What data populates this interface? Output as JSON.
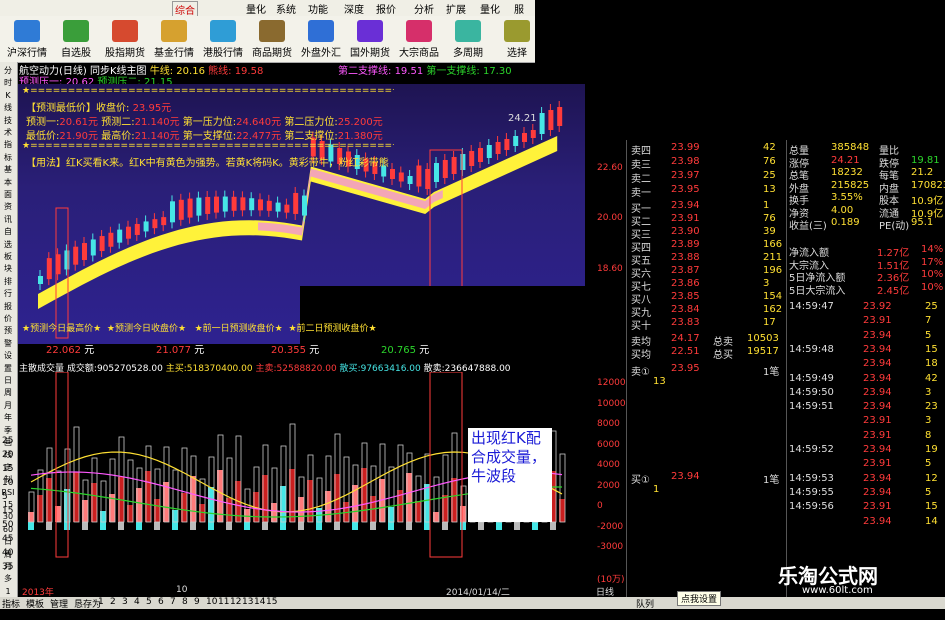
{
  "menu": {
    "items": [
      "综合",
      "量化",
      "系统",
      "功能",
      "深度",
      "报价",
      "分析",
      "扩展",
      "量化",
      "服"
    ],
    "active_index": 0
  },
  "toolbar": [
    {
      "label": "沪深行情",
      "icon": "market-icon",
      "color": "#2f7bd6"
    },
    {
      "label": "自选股",
      "icon": "favorites-icon",
      "color": "#3a9e3a"
    },
    {
      "label": "股指期货",
      "icon": "futures-icon",
      "color": "#d64a2f"
    },
    {
      "label": "基金行情",
      "icon": "fund-icon",
      "color": "#d6a12f"
    },
    {
      "label": "港股行情",
      "icon": "hk-icon",
      "color": "#2f9dd6"
    },
    {
      "label": "商品期货",
      "icon": "commodity-icon",
      "color": "#8a6a2f"
    },
    {
      "label": "外盘外汇",
      "icon": "forex-icon",
      "color": "#2f6fd6"
    },
    {
      "label": "国外期货",
      "icon": "foreign-futures-icon",
      "color": "#6a2fd6"
    },
    {
      "label": "大宗商品",
      "icon": "bulk-icon",
      "color": "#d62f6a"
    },
    {
      "label": "多周期",
      "icon": "multi-period-icon",
      "color": "#3ab5a0"
    },
    {
      "label": "选择",
      "icon": "select-icon",
      "color": "#9a9a2f"
    }
  ],
  "left_buttons": [
    "分",
    "时",
    "K",
    "线",
    "技",
    "术",
    "指",
    "标",
    "基",
    "本",
    "面",
    "资",
    "讯",
    "自",
    "选",
    "板",
    "块",
    "排",
    "行",
    "报",
    "价",
    "预",
    "警",
    "设",
    "置",
    "日",
    "周",
    "月",
    "年",
    "季",
    "画",
    "线",
    "定",
    "制",
    "RSI",
    "15",
    "30",
    "60",
    "日",
    "周",
    "月",
    "多",
    "1"
  ],
  "chart_title": {
    "text": "航空动力(日线) 同步K线主图",
    "ma_label": "牛线",
    "ma_value": "20.16",
    "ma2_label": "熊线",
    "ma2_value": "19.58",
    "line2_label": "第二支撑线",
    "line2_value": "19.51",
    "line1_label": "第一支撑线",
    "line1_value": "17.30"
  },
  "predict_header": {
    "label1": "预测压一",
    "value1": "20.62",
    "label2": "预测压二",
    "value2": "21.15"
  },
  "info_lines": {
    "line1": "【预测最低价】收盘价:",
    "line1_val": "23.95元",
    "line2a": "预测一:",
    "line2a_v": "20.61元",
    "line2b": "预测二:",
    "line2b_v": "21.140元",
    "line2c": "第一压力位:",
    "line2c_v": "24.640元",
    "line2d": "第二压力位:",
    "line2d_v": "25.200元",
    "line3a": "最低价:",
    "line3a_v": "21.90元",
    "line3b": "最高价:",
    "line3b_v": "21.140元",
    "line3c": "第一支撑位:",
    "line3c_v": "22.477元",
    "line3d": "第二支撑位:",
    "line3d_v": "21.380元",
    "usage": "【用法】红K买看K来。红K中有黄色为强势。若黄K将码K。黄彩带牛，粉红彩带熊"
  },
  "price_marks": [
    "22.60",
    "20.00",
    "18.60"
  ],
  "right_top_value": "24.21",
  "sep_line": "★================================================★",
  "predict_labels": {
    "a": "★预测今日最高价★",
    "b": "★预测今日收盘价★",
    "c": "★前一日预测收盘价★",
    "d": "★前二日预测收盘价★"
  },
  "predict_values": {
    "a": "22.062",
    "b": "21.077",
    "c": "20.355",
    "d": "20.765",
    "unit": "元"
  },
  "vol_header": {
    "a": "主散成交量",
    "b": "成交额",
    "b_v": "905270528.00",
    "c": "主买",
    "c_v": "518370400.00",
    "d": "主卖",
    "d_v": "52588820.00",
    "e": "散买",
    "e_v": "97663416.00",
    "f": "散卖",
    "f_v": "236647888.00"
  },
  "vol_axis": [
    "12000",
    "10000",
    "8000",
    "6000",
    "4000",
    "2000",
    "0",
    "-2000",
    "-3000"
  ],
  "vol_unit": "(10万)",
  "left_vol_axis": [
    "25",
    "20",
    "15",
    "10",
    "5",
    "15",
    "50",
    "45",
    "40",
    "35"
  ],
  "date_axis": {
    "left": "2013年",
    "mid": "10",
    "right": "2014/01/14/二"
  },
  "note": "出现红K配合成交量，牛波段",
  "orderbook": {
    "sells": [
      {
        "label": "卖四",
        "price": "23.99",
        "vol": "42"
      },
      {
        "label": "卖三",
        "price": "23.98",
        "vol": "76"
      },
      {
        "label": "卖二",
        "price": "23.97",
        "vol": "25"
      },
      {
        "label": "卖一",
        "price": "23.95",
        "vol": "13"
      }
    ],
    "buys": [
      {
        "label": "买一",
        "price": "23.94",
        "vol": "1"
      },
      {
        "label": "买二",
        "price": "23.91",
        "vol": "76"
      },
      {
        "label": "买三",
        "price": "23.90",
        "vol": "39"
      },
      {
        "label": "买四",
        "price": "23.89",
        "vol": "166"
      },
      {
        "label": "买五",
        "price": "23.88",
        "vol": "211"
      },
      {
        "label": "买六",
        "price": "23.87",
        "vol": "196"
      },
      {
        "label": "买七",
        "price": "23.86",
        "vol": "3"
      },
      {
        "label": "买八",
        "price": "23.85",
        "vol": "154"
      },
      {
        "label": "买九",
        "price": "23.84",
        "vol": "162"
      },
      {
        "label": "买十",
        "price": "23.83",
        "vol": "17"
      }
    ],
    "avg_sell": {
      "label": "卖均",
      "price": "24.17",
      "tlabel": "总卖",
      "tval": "10503"
    },
    "avg_buy": {
      "label": "买均",
      "price": "22.51",
      "tlabel": "总买",
      "tval": "19517"
    },
    "sell1_detail": {
      "label": "卖①",
      "price": "23.95",
      "count": "1笔",
      "vol": "13"
    },
    "buy1_detail": {
      "label": "买①",
      "price": "23.94",
      "count": "1笔",
      "vol": "1"
    }
  },
  "quote": [
    {
      "a": "总量",
      "av": "385848",
      "b": "量比",
      "bv": ""
    },
    {
      "a": "涨停",
      "av": "24.21",
      "b": "跌停",
      "bv": "19.81"
    },
    {
      "a": "总笔",
      "av": "18232",
      "b": "每笔",
      "bv": "21.2"
    },
    {
      "a": "外盘",
      "av": "215825",
      "b": "内盘",
      "bv": "170823"
    },
    {
      "a": "换手",
      "av": "3.55%",
      "b": "股本",
      "bv": "10.9亿"
    },
    {
      "a": "净资",
      "av": "4.00",
      "b": "流通",
      "bv": "10.9亿"
    },
    {
      "a": "收益(三)",
      "av": "0.189",
      "b": "PE(动)",
      "bv": "95.1"
    }
  ],
  "flows": [
    {
      "label": "净流入额",
      "value": "1.27亿",
      "pct": "14%"
    },
    {
      "label": "大宗流入",
      "value": "1.51亿",
      "pct": "17%"
    },
    {
      "label": "5日净流入额",
      "value": "2.36亿",
      "pct": "10%"
    },
    {
      "label": "5日大宗流入",
      "value": "2.45亿",
      "pct": "10%"
    }
  ],
  "ticks": [
    {
      "t": "14:59:47",
      "p": "23.92",
      "v": "25"
    },
    {
      "t": "",
      "p": "23.91",
      "v": "7"
    },
    {
      "t": "",
      "p": "23.94",
      "v": "5"
    },
    {
      "t": "14:59:48",
      "p": "23.94",
      "v": "15"
    },
    {
      "t": "",
      "p": "23.94",
      "v": "18"
    },
    {
      "t": "14:59:49",
      "p": "23.94",
      "v": "42"
    },
    {
      "t": "14:59:50",
      "p": "23.94",
      "v": "3"
    },
    {
      "t": "14:59:51",
      "p": "23.94",
      "v": "23"
    },
    {
      "t": "",
      "p": "23.91",
      "v": "3"
    },
    {
      "t": "",
      "p": "23.91",
      "v": "8"
    },
    {
      "t": "14:59:52",
      "p": "23.94",
      "v": "19"
    },
    {
      "t": "",
      "p": "23.91",
      "v": "5"
    },
    {
      "t": "14:59:53",
      "p": "23.94",
      "v": "12"
    },
    {
      "t": "14:59:55",
      "p": "23.94",
      "v": "5"
    },
    {
      "t": "14:59:56",
      "p": "23.91",
      "v": "15"
    },
    {
      "t": "",
      "p": "23.94",
      "v": "14"
    }
  ],
  "bottom_tabs": [
    "指标",
    "模板",
    "管理",
    "恳存为",
    "1",
    "2",
    "3",
    "4",
    "5",
    "6",
    "7",
    "8",
    "9",
    "10",
    "11",
    "12",
    "13",
    "14",
    "15"
  ],
  "bottom_right": {
    "a": "日线",
    "b": "队列",
    "tooltip": "点我设置"
  },
  "watermark": {
    "a": "乐淘公式网",
    "b": "www.60lt.com"
  }
}
